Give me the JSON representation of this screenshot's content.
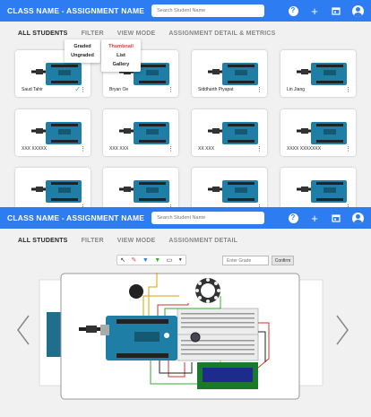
{
  "gallery_screen": {
    "header": {
      "title": "CLASS NAME - ASSIGNMENT NAME",
      "search_placeholder": "Search Student Name",
      "help_icon": "help-circle-icon",
      "add_icon": "plus-icon",
      "calendar_icon": "calendar-icon",
      "account_icon": "account-avatar-icon",
      "color": "#2e7cf2"
    },
    "tabs": [
      "ALL STUDENTS",
      "FILTER",
      "VIEW MODE",
      "ASSIGNMENT DETAIL & METRICS"
    ],
    "filter_menu": [
      "Graded",
      "Ungraded"
    ],
    "view_mode_menu": {
      "items": [
        "Thumbnail",
        "List",
        "Gallery"
      ],
      "selected": "Thumbnail",
      "selected_color": "#e23b3b"
    },
    "cards": [
      {
        "name": "Saud Tahir",
        "graded": true
      },
      {
        "name": "Bryan Oe",
        "graded": false
      },
      {
        "name": "Siddharth Piyapat",
        "graded": false
      },
      {
        "name": "Lin Jiang",
        "graded": false
      },
      {
        "name": "XXX XXXXX",
        "graded": false
      },
      {
        "name": "XXX XXX",
        "graded": false
      },
      {
        "name": "XX XXX",
        "graded": false
      },
      {
        "name": "XXXX XXXXXXX",
        "graded": false
      },
      {
        "name": "",
        "graded": false
      },
      {
        "name": "",
        "graded": false
      },
      {
        "name": "",
        "graded": false
      },
      {
        "name": "",
        "graded": false
      }
    ]
  },
  "detail_screen": {
    "header": {
      "title": "CLASS NAME - ASSIGNMENT NAME",
      "search_placeholder": "Search Student Name"
    },
    "tabs": [
      "ALL STUDENTS",
      "FILTER",
      "VIEW MODE",
      "ASSIGNMENT DETAIL"
    ],
    "toolbar_icons": [
      "cursor-icon",
      "pen-icon",
      "marker-icon",
      "highlighter-icon",
      "eraser-icon",
      "chevron-down-icon"
    ],
    "score_placeholder": "Enter Grade",
    "confirm_label": "Confirm",
    "nav": {
      "prev_icon": "chevron-left-icon",
      "next_icon": "chevron-right-icon"
    }
  }
}
